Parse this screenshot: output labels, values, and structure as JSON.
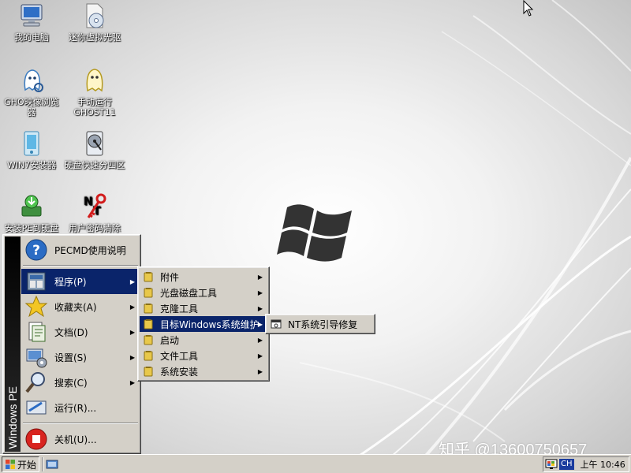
{
  "desktop": {
    "icons": [
      {
        "label": "我的电脑",
        "icon": "my-computer-icon"
      },
      {
        "label": "迷你虚拟光驱",
        "icon": "virtual-drive-icon"
      },
      {
        "label": "GHO映像浏览器",
        "icon": "ghost-browser-icon"
      },
      {
        "label": "手动运行GHOST11",
        "icon": "ghost-run-icon"
      },
      {
        "label": "WIN7安装器",
        "icon": "win7-installer-icon"
      },
      {
        "label": "硬盘快速分四区",
        "icon": "disk-partition-icon"
      },
      {
        "label": "安装PE到硬盘",
        "icon": "install-pe-icon"
      },
      {
        "label": "用户密码清除",
        "icon": "password-clear-icon"
      }
    ],
    "watermark": "知乎 @13600750657"
  },
  "start_menu": {
    "side_text": "Windows PE",
    "items": [
      {
        "label": "PECMD使用说明",
        "icon": "help-icon"
      },
      {
        "label": "程序(P)",
        "icon": "programs-icon",
        "has_submenu": true
      },
      {
        "label": "收藏夹(A)",
        "icon": "favorites-icon",
        "has_submenu": true
      },
      {
        "label": "文档(D)",
        "icon": "documents-icon",
        "has_submenu": true
      },
      {
        "label": "设置(S)",
        "icon": "settings-icon",
        "has_submenu": true
      },
      {
        "label": "搜索(C)",
        "icon": "search-icon",
        "has_submenu": true
      },
      {
        "label": "运行(R)...",
        "icon": "run-icon"
      },
      {
        "label": "关机(U)...",
        "icon": "shutdown-icon"
      }
    ]
  },
  "programs_submenu": {
    "items": [
      {
        "label": "附件"
      },
      {
        "label": "光盘磁盘工具"
      },
      {
        "label": "克隆工具"
      },
      {
        "label": "目标Windows系统维护"
      },
      {
        "label": "启动"
      },
      {
        "label": "文件工具"
      },
      {
        "label": "系统安装"
      }
    ]
  },
  "maintenance_submenu": {
    "items": [
      {
        "label": "NT系统引导修复"
      }
    ]
  },
  "taskbar": {
    "start_label": "开始",
    "lang": "CH",
    "clock": "上午 10:46"
  },
  "colors": {
    "menu_bg": "#d4d0c8",
    "highlight": "#0a246a",
    "side_band": "#000000"
  }
}
